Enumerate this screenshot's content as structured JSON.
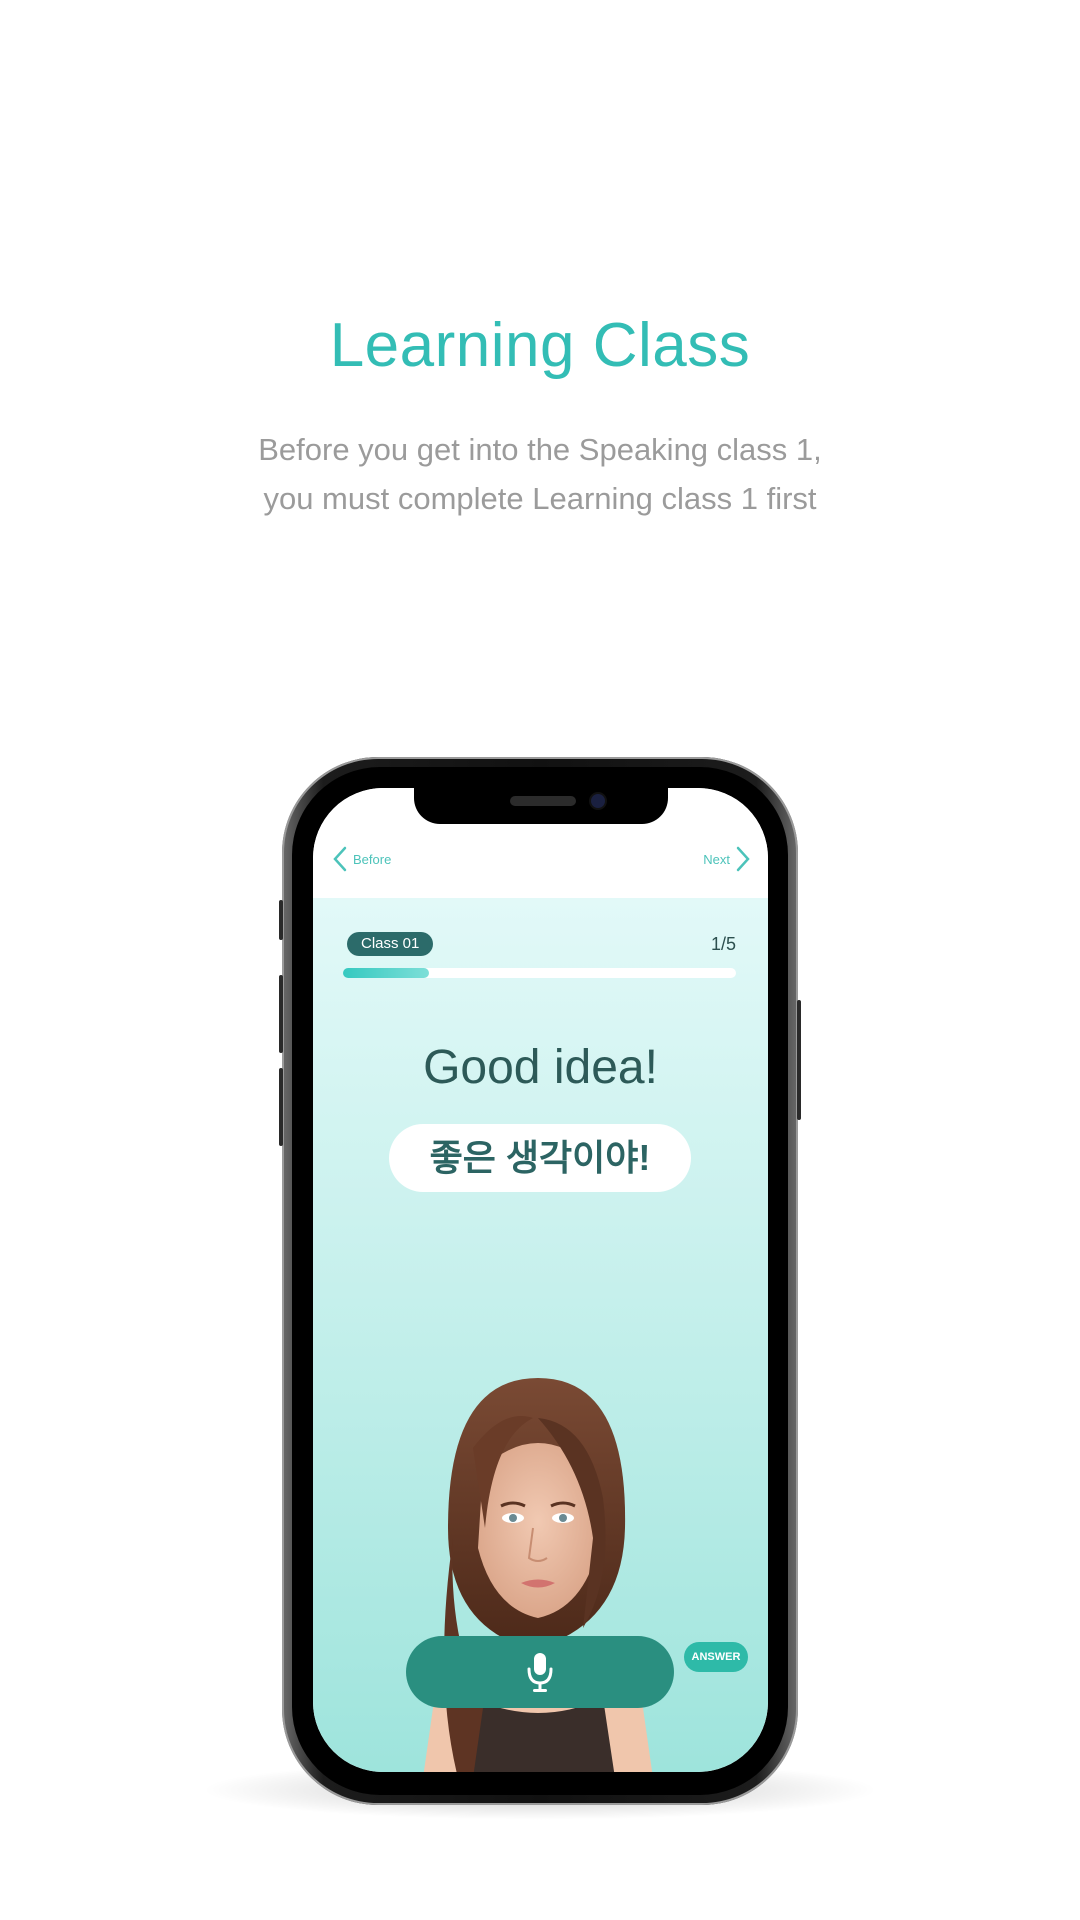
{
  "header": {
    "title": "Learning Class",
    "description_line1": "Before you get into the Speaking class 1,",
    "description_line2": "you must complete Learning class 1 first"
  },
  "app": {
    "nav": {
      "before_label": "Before",
      "next_label": "Next"
    },
    "class_label": "Class 01",
    "page_counter": "1/5",
    "progress_fraction": 0.22,
    "phrase_english": "Good idea!",
    "phrase_korean": "좋은 생각이야!",
    "answer_label": "ANSWER",
    "icons": {
      "back": "chevron-left-icon",
      "next": "chevron-right-icon",
      "mic": "microphone-icon"
    },
    "colors": {
      "accent": "#33bdb5",
      "dark_teal": "#2a8f80",
      "pill": "#2c6b6a"
    }
  }
}
